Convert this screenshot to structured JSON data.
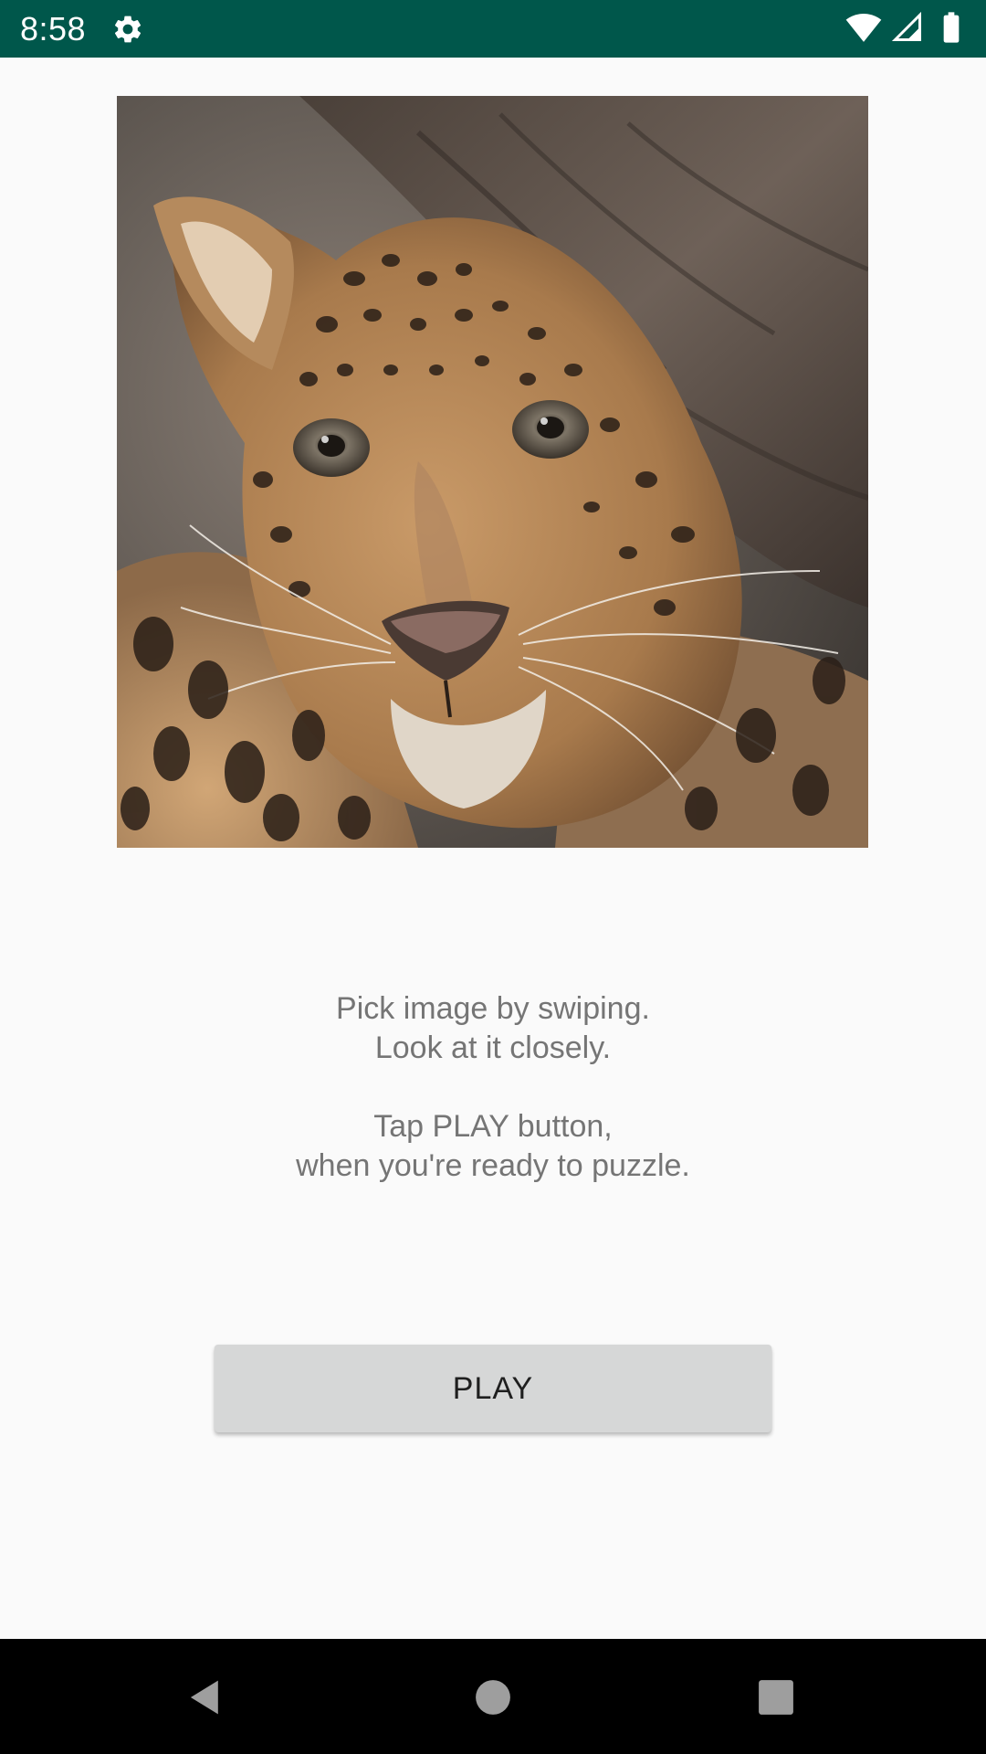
{
  "status_bar": {
    "time": "8:58",
    "icons": [
      "gear-icon",
      "wifi-icon",
      "signal-icon",
      "battery-icon"
    ],
    "background_color": "#00574b"
  },
  "main": {
    "image": {
      "subject": "leopard",
      "icon": "leopard-image"
    },
    "instructions": {
      "line1": "Pick image by swiping.",
      "line2": "Look at it closely.",
      "line3": "Tap PLAY button,",
      "line4": "when you're ready to puzzle."
    },
    "play_button": {
      "label": "PLAY"
    }
  },
  "nav_bar": {
    "icons": [
      "back-icon",
      "home-icon",
      "recents-icon"
    ]
  }
}
